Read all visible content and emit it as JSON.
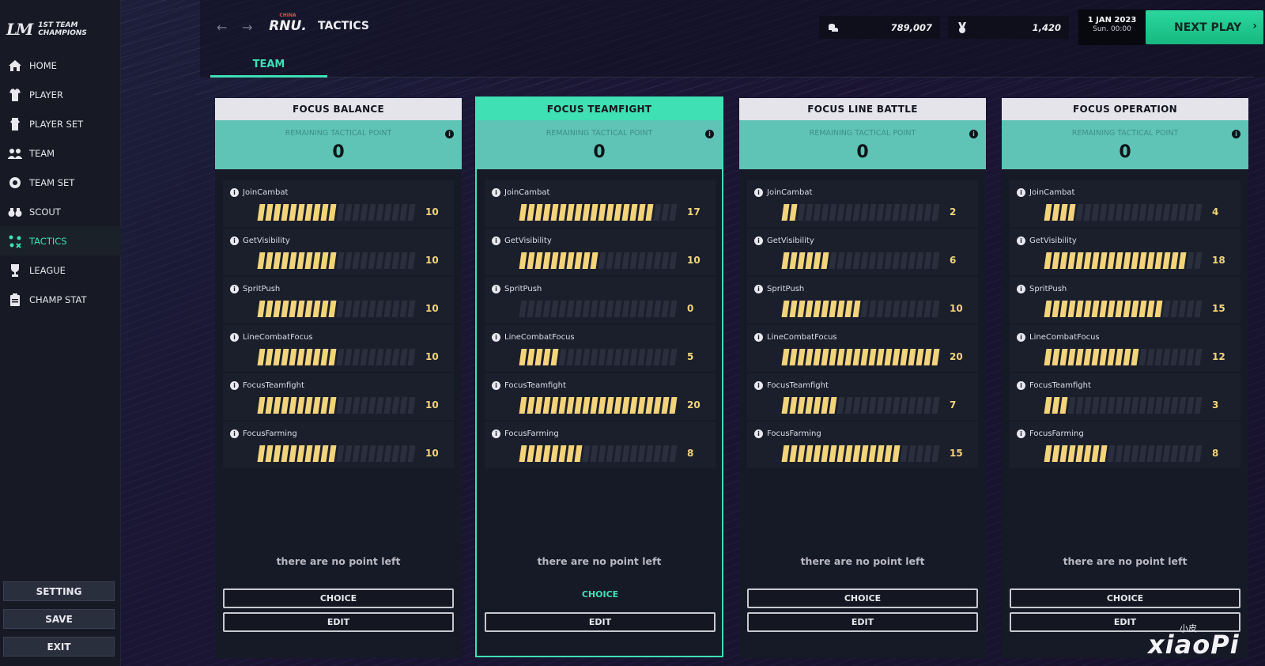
{
  "app": {
    "logo_mark": "LM",
    "logo_line1": "1ST TEAM",
    "logo_line2": "CHAMPIONS"
  },
  "sidebar": {
    "items": [
      {
        "label": "HOME",
        "icon": "home-icon"
      },
      {
        "label": "PLAYER",
        "icon": "player-icon"
      },
      {
        "label": "PLAYER SET",
        "icon": "player-set-icon"
      },
      {
        "label": "TEAM",
        "icon": "team-icon"
      },
      {
        "label": "TEAM SET",
        "icon": "team-set-icon"
      },
      {
        "label": "SCOUT",
        "icon": "binoculars-icon"
      },
      {
        "label": "TACTICS",
        "icon": "tactics-icon",
        "active": true
      },
      {
        "label": "LEAGUE",
        "icon": "trophy-icon"
      },
      {
        "label": "CHAMP STAT",
        "icon": "clipboard-icon"
      }
    ],
    "setting": "SETTING",
    "save": "SAVE",
    "exit": "EXIT"
  },
  "header": {
    "club_small": "CHINA",
    "club_name": "RNU.",
    "title": "TACTICS",
    "tab": "TEAM",
    "coins": "789,007",
    "medals": "1,420",
    "date": "1 JAN 2023",
    "day_time": "Sun. 00:00",
    "next_play": "NEXT PLAY"
  },
  "colors": {
    "accent": "#3ee0b4",
    "bar_on": "#f3d47a",
    "point_panel": "#5fc4b6"
  },
  "max_points": 20,
  "remaining_label": "REMAINING TACTICAL POINT",
  "no_point_text": "there are no point left",
  "choice_label": "CHOICE",
  "edit_label": "EDIT",
  "cards": [
    {
      "title": "FOCUS BALANCE",
      "remaining": "0",
      "selected": false,
      "attrs": [
        {
          "name": "JoinCambat",
          "value": 10
        },
        {
          "name": "GetVisibility",
          "value": 10
        },
        {
          "name": "SpritPush",
          "value": 10
        },
        {
          "name": "LineCombatFocus",
          "value": 10
        },
        {
          "name": "FocusTeamfight",
          "value": 10
        },
        {
          "name": "FocusFarming",
          "value": 10
        }
      ]
    },
    {
      "title": "FOCUS TEAMFIGHT",
      "remaining": "0",
      "selected": true,
      "attrs": [
        {
          "name": "JoinCambat",
          "value": 17
        },
        {
          "name": "GetVisibility",
          "value": 10
        },
        {
          "name": "SpritPush",
          "value": 0
        },
        {
          "name": "LineCombatFocus",
          "value": 5
        },
        {
          "name": "FocusTeamfight",
          "value": 20
        },
        {
          "name": "FocusFarming",
          "value": 8
        }
      ]
    },
    {
      "title": "FOCUS LINE BATTLE",
      "remaining": "0",
      "selected": false,
      "attrs": [
        {
          "name": "JoinCambat",
          "value": 2
        },
        {
          "name": "GetVisibility",
          "value": 6
        },
        {
          "name": "SpritPush",
          "value": 10
        },
        {
          "name": "LineCombatFocus",
          "value": 20
        },
        {
          "name": "FocusTeamfight",
          "value": 7
        },
        {
          "name": "FocusFarming",
          "value": 15
        }
      ]
    },
    {
      "title": "FOCUS OPERATION",
      "remaining": "0",
      "selected": false,
      "attrs": [
        {
          "name": "JoinCambat",
          "value": 4
        },
        {
          "name": "GetVisibility",
          "value": 18
        },
        {
          "name": "SpritPush",
          "value": 15
        },
        {
          "name": "LineCombatFocus",
          "value": 12
        },
        {
          "name": "FocusTeamfight",
          "value": 3
        },
        {
          "name": "FocusFarming",
          "value": 8
        }
      ]
    }
  ],
  "watermark": {
    "small": "小皮",
    "big": "xiaoPi"
  }
}
